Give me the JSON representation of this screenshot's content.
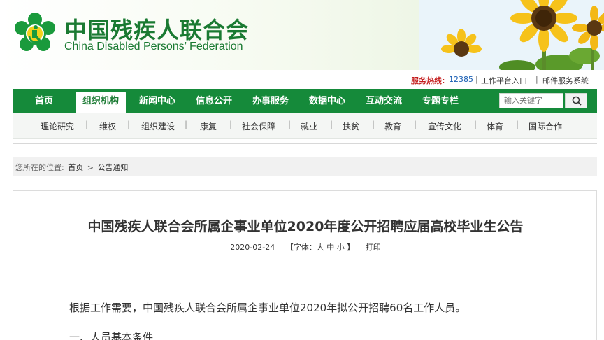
{
  "header": {
    "title_cn": "中国残疾人联合会",
    "title_en": "China Disabled Persons’ Federation"
  },
  "service_bar": {
    "hotline_label": "服务热线:",
    "hotline_number": "12385",
    "links": [
      "工作平台入口",
      "邮件服务系统"
    ]
  },
  "main_nav": {
    "items": [
      "首页",
      "组织机构",
      "新闻中心",
      "信息公开",
      "办事服务",
      "数据中心",
      "互动交流",
      "专题专栏"
    ],
    "active_index": 1,
    "search_placeholder": "输入关键字"
  },
  "sub_nav": {
    "items": [
      "理论研究",
      "维权",
      "组织建设",
      "康复",
      "社会保障",
      "就业",
      "扶贫",
      "教育",
      "宣传文化",
      "体育",
      "国际合作"
    ]
  },
  "breadcrumb": {
    "prefix": "您所在的位置:",
    "items": [
      "首页",
      "公告通知"
    ],
    "separator": ">"
  },
  "article": {
    "title": "中国残疾人联合会所属企事业单位2020年度公开招聘应届高校毕业生公告",
    "date": "2020-02-24",
    "font_label": "【字体：大 中 小 】",
    "print_label": "打印",
    "paragraph1": "根据工作需要，中国残疾人联合会所属企事业单位2020年拟公开招聘60名工作人员。",
    "paragraph2": "一、人员基本条件"
  },
  "colors": {
    "brand_green": "#158a3a",
    "title_green": "#1a7a32",
    "hotline_red": "#c41d1d"
  }
}
